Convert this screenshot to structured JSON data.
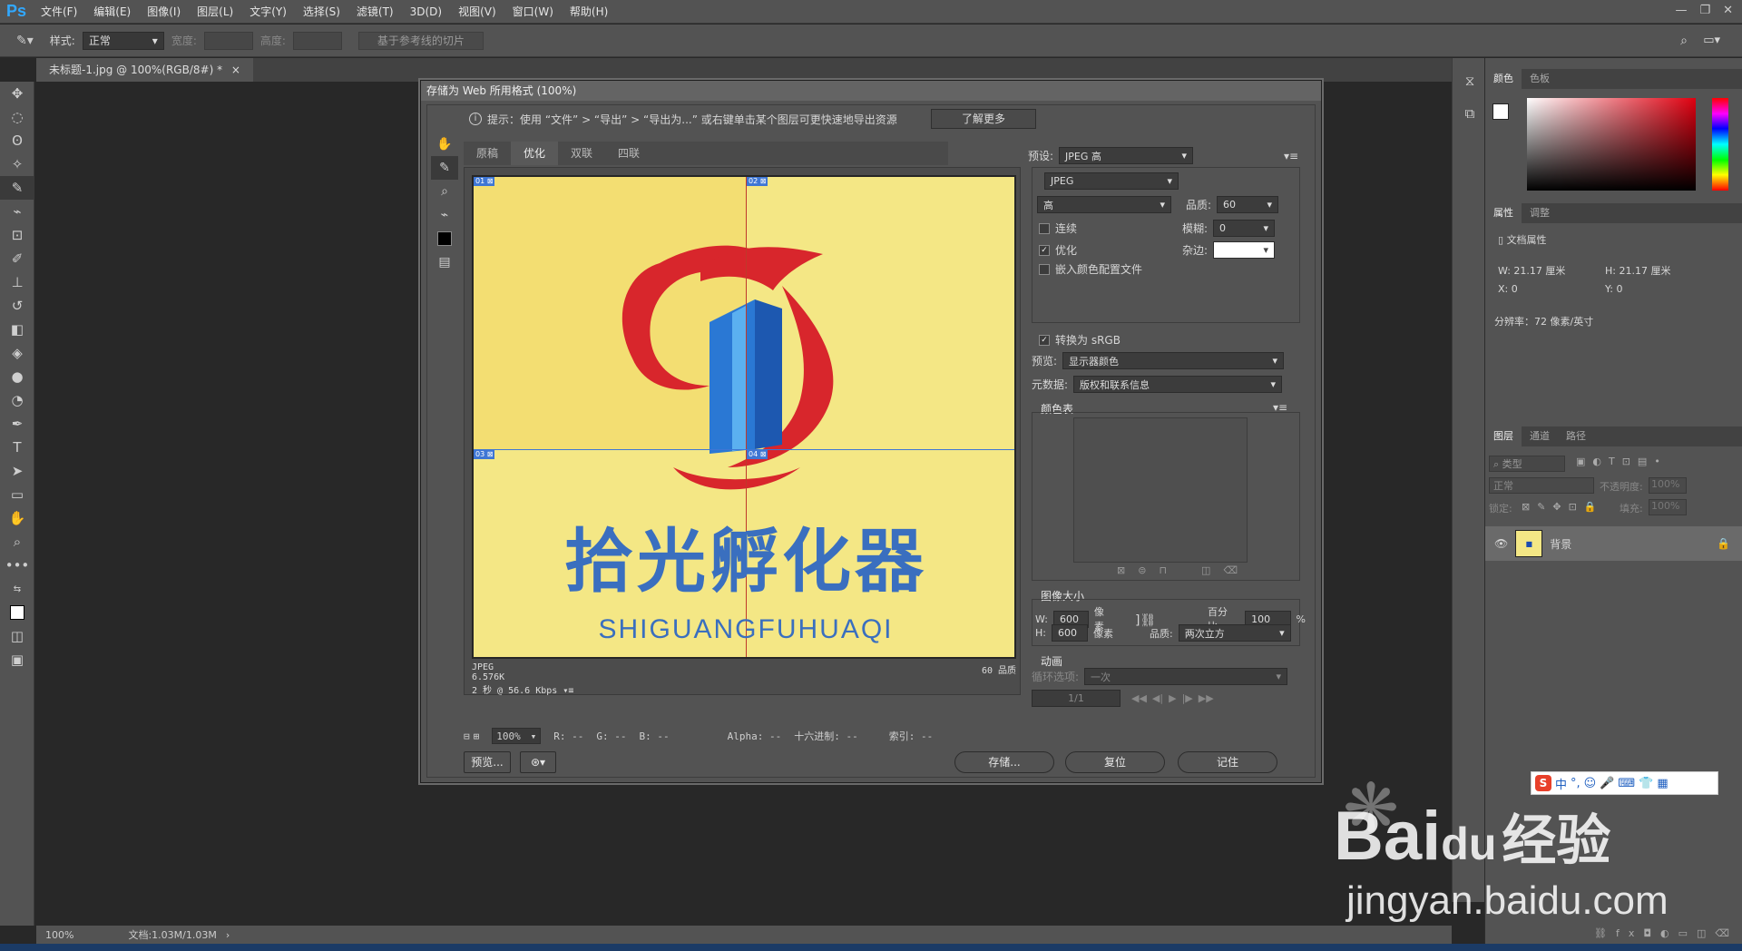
{
  "app": {
    "logo": "Ps"
  },
  "menu": [
    "文件(F)",
    "编辑(E)",
    "图像(I)",
    "图层(L)",
    "文字(Y)",
    "选择(S)",
    "滤镜(T)",
    "3D(D)",
    "视图(V)",
    "窗口(W)",
    "帮助(H)"
  ],
  "options": {
    "style_label": "样式:",
    "style_value": "正常",
    "width_label": "宽度:",
    "height_label": "高度:",
    "guide_button": "基于参考线的切片"
  },
  "document": {
    "tab_title": "未标题-1.jpg @ 100%(RGB/8#) *",
    "zoom": "100%",
    "doc_info": "文档:1.03M/1.03M"
  },
  "dialog": {
    "title": "存储为 Web 所用格式 (100%)",
    "hint": "提示：使用 “文件” > “导出” > “导出为...” 或右键单击某个图层可更快速地导出资源",
    "learn_more": "了解更多",
    "tabs": [
      "原稿",
      "优化",
      "双联",
      "四联"
    ],
    "slices": [
      "01",
      "02",
      "03",
      "04"
    ],
    "image_title": "拾光孵化器",
    "image_subtitle": "SHIGUANGFUHUAQI",
    "info_format": "JPEG",
    "info_size": "6.576K",
    "info_time": "2 秒 @ 56.6 Kbps",
    "info_quality": "60 品质",
    "status": {
      "zoom": "100%",
      "r": "R: --",
      "g": "G: --",
      "b": "B: --",
      "alpha": "Alpha: --",
      "hex": "十六进制: --",
      "index": "索引: --"
    },
    "buttons": {
      "preview": "预览...",
      "save": "存储...",
      "reset": "复位",
      "remember": "记住"
    },
    "settings": {
      "preset_label": "预设:",
      "preset_value": "JPEG 高",
      "format_value": "JPEG",
      "quality_preset": "高",
      "quality_label": "品质:",
      "quality_value": "60",
      "progressive": "连续",
      "blur_label": "模糊:",
      "blur_value": "0",
      "optimized": "优化",
      "matte_label": "杂边:",
      "embed_profile": "嵌入颜色配置文件",
      "convert_srgb": "转换为 sRGB",
      "preview_label": "预览:",
      "preview_value": "显示器颜色",
      "metadata_label": "元数据:",
      "metadata_value": "版权和联系信息",
      "color_table": "颜色表",
      "image_size": "图像大小",
      "w_label": "W:",
      "w_value": "600",
      "h_label": "H:",
      "h_value": "600",
      "px": "像素",
      "percent_label": "百分比:",
      "percent_value": "100",
      "percent_unit": "%",
      "resample_label": "品质:",
      "resample_value": "两次立方",
      "animation": "动画",
      "loop_label": "循环选项:",
      "loop_value": "一次",
      "frame_counter": "1/1"
    }
  },
  "panels": {
    "color_tabs": [
      "颜色",
      "色板"
    ],
    "prop_tabs": [
      "属性",
      "调整"
    ],
    "doc_props": "文档属性",
    "w": "W:  21.17 厘米",
    "h": "H:  21.17 厘米",
    "x": "X:  0",
    "y": "Y:  0",
    "resolution": "分辨率：72 像素/英寸",
    "layer_tabs": [
      "图层",
      "通道",
      "路径"
    ],
    "filter_placeholder": "类型",
    "blend_mode": "正常",
    "opacity_label": "不透明度:",
    "opacity_value": "100%",
    "lock_label": "锁定:",
    "fill_label": "填充:",
    "fill_value": "100%",
    "layer_name": "背景"
  },
  "ime": {
    "items": [
      "中",
      "°,",
      "☺",
      "🎤",
      "⌨",
      "👕",
      "▦"
    ]
  },
  "watermark": {
    "brand": "Bai",
    "brand_du": "du",
    "brand_cn": "经验",
    "url": "jingyan.baidu.com"
  },
  "colors": {
    "accent": "#31a8ff",
    "image_bg": "#f4e785",
    "logo_blue": "#3a6fbf",
    "logo_red": "#d8262c"
  }
}
